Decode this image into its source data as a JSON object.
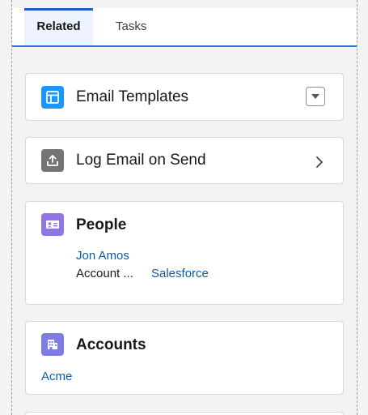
{
  "tabs": [
    {
      "label": "Related",
      "active": true
    },
    {
      "label": "Tasks",
      "active": false
    }
  ],
  "cards": {
    "email_templates": {
      "title": "Email Templates",
      "icon": "template-icon",
      "icon_color": "#1b96ff"
    },
    "log_email": {
      "title": "Log Email on Send",
      "icon": "upload-icon",
      "icon_color": "#747474"
    },
    "people": {
      "title": "People",
      "icon": "contact-card-icon",
      "icon_color": "#8f75e6",
      "person_name": "Jon Amos",
      "field_label": "Account ...",
      "field_value": "Salesforce"
    },
    "accounts": {
      "title": "Accounts",
      "icon": "building-icon",
      "icon_color": "#7f7ce6",
      "account_name": "Acme"
    }
  }
}
